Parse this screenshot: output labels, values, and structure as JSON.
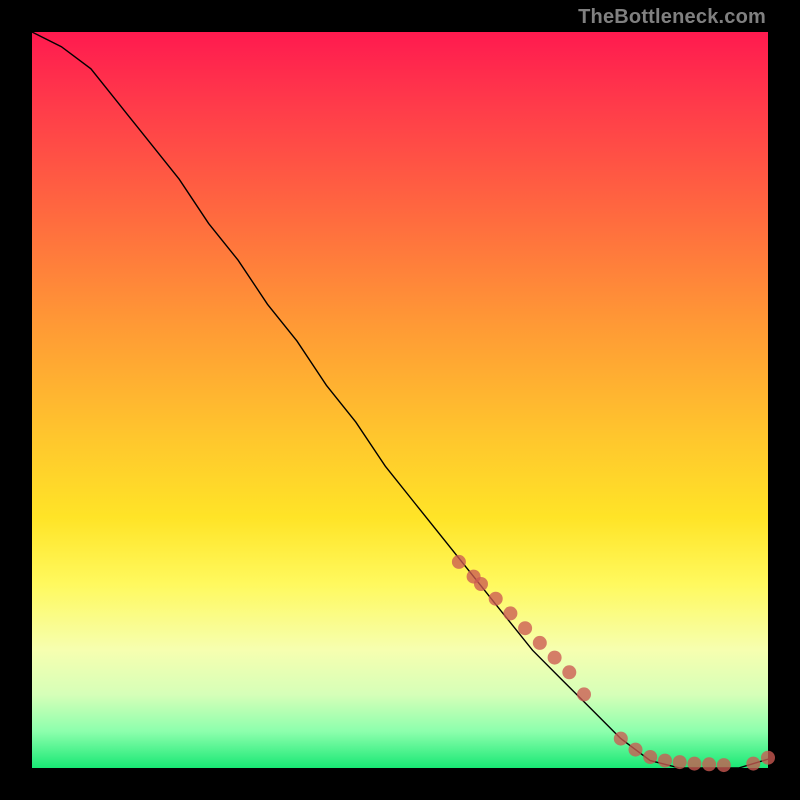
{
  "watermark": "TheBottleneck.com",
  "colors": {
    "background": "#000000",
    "gradient_top": "#ff1a4f",
    "gradient_bottom": "#18e874",
    "curve": "#000000",
    "dot": "#cc5a52"
  },
  "chart_data": {
    "type": "line",
    "title": "",
    "xlabel": "",
    "ylabel": "",
    "xlim": [
      0,
      100
    ],
    "ylim": [
      0,
      100
    ],
    "x": [
      0,
      4,
      8,
      12,
      16,
      20,
      24,
      28,
      32,
      36,
      40,
      44,
      48,
      52,
      56,
      60,
      64,
      68,
      72,
      76,
      80,
      84,
      88,
      92,
      96,
      100
    ],
    "y": [
      100,
      98,
      95,
      90,
      85,
      80,
      74,
      69,
      63,
      58,
      52,
      47,
      41,
      36,
      31,
      26,
      21,
      16,
      12,
      8,
      4,
      1,
      0,
      0,
      0,
      1.2
    ],
    "scatter": {
      "x": [
        58,
        60,
        61,
        63,
        65,
        67,
        69,
        71,
        73,
        75,
        80,
        82,
        84,
        86,
        88,
        90,
        92,
        94,
        98,
        100
      ],
      "y": [
        28,
        26,
        25,
        23,
        21,
        19,
        17,
        15,
        13,
        10,
        4,
        2.5,
        1.5,
        1,
        0.8,
        0.6,
        0.5,
        0.4,
        0.6,
        1.4
      ]
    }
  }
}
